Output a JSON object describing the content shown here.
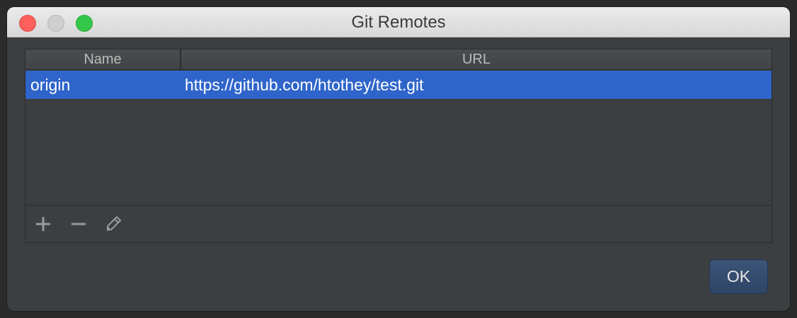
{
  "window": {
    "title": "Git Remotes"
  },
  "table": {
    "columns": [
      "Name",
      "URL"
    ],
    "rows": [
      {
        "name": "origin",
        "url": "https://github.com/htothey/test.git",
        "selected": true
      }
    ]
  },
  "toolbar": {
    "icons": [
      "add-icon",
      "remove-icon",
      "edit-icon"
    ]
  },
  "actions": {
    "ok_label": "OK"
  },
  "colors": {
    "selection": "#2f65ca",
    "background": "#3c3f41",
    "ok_button": "#34496b"
  }
}
